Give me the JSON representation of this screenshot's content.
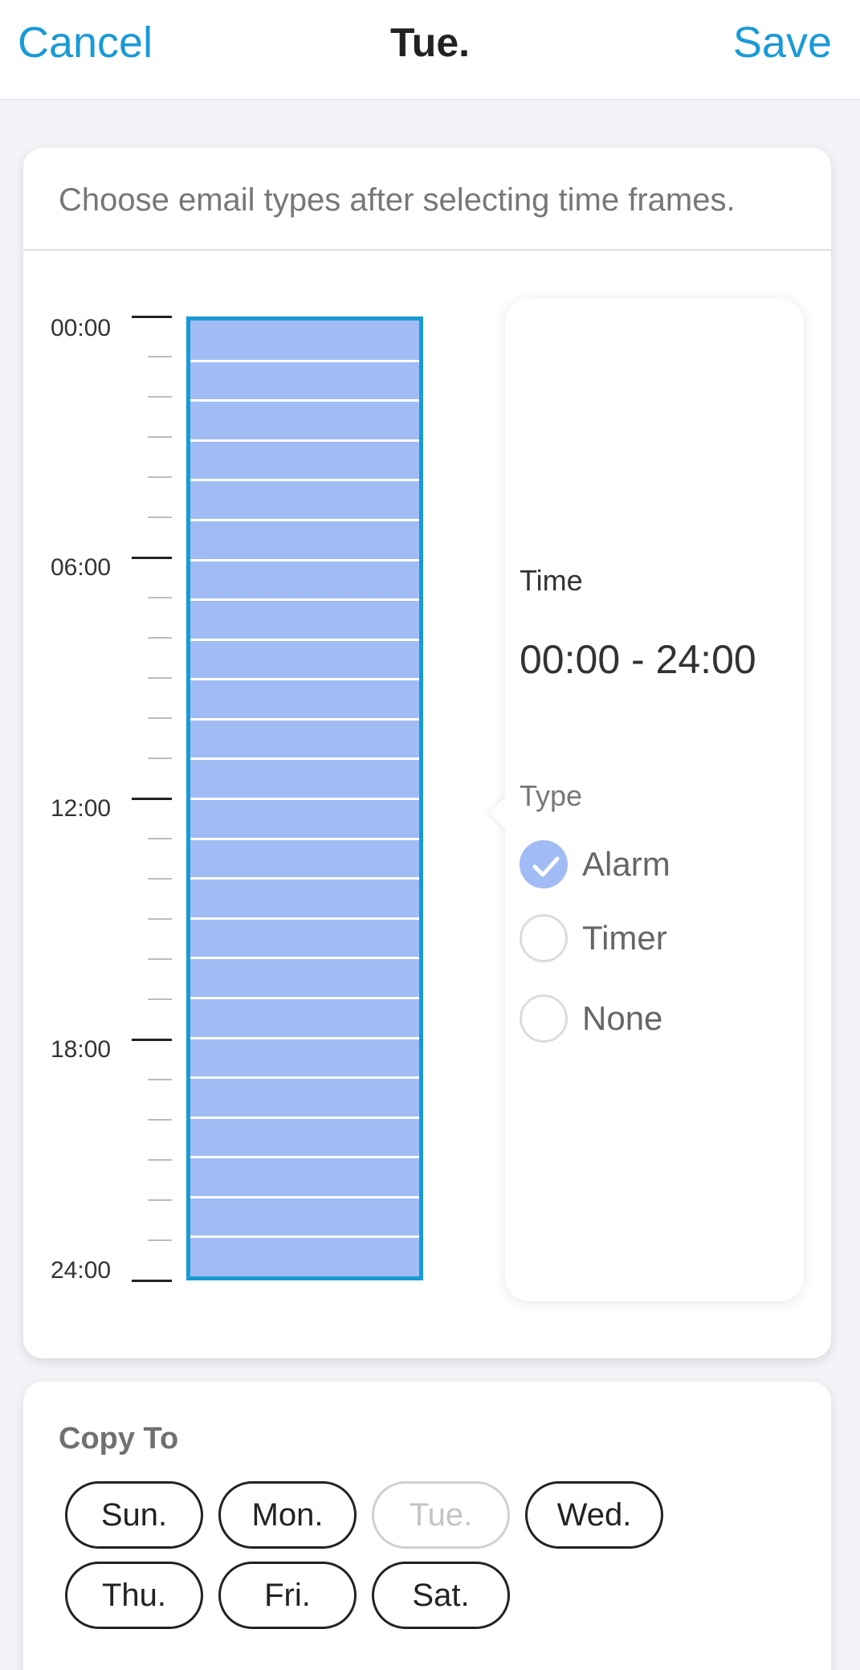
{
  "header": {
    "cancel_label": "Cancel",
    "title": "Tue.",
    "save_label": "Save"
  },
  "schedule": {
    "hint": "Choose email types after selecting time frames.",
    "axis_labels": [
      "00:00",
      "06:00",
      "12:00",
      "18:00",
      "24:00"
    ],
    "selected_fill_color": "#a1bcf5",
    "selected_border_color": "#189ad5"
  },
  "popup": {
    "time_label": "Time",
    "time_value": "00:00 - 24:00",
    "type_label": "Type",
    "options": [
      {
        "label": "Alarm",
        "checked": true
      },
      {
        "label": "Timer",
        "checked": false
      },
      {
        "label": "None",
        "checked": false
      }
    ]
  },
  "copy_to": {
    "title": "Copy To",
    "days": [
      {
        "label": "Sun.",
        "disabled": false
      },
      {
        "label": "Mon.",
        "disabled": false
      },
      {
        "label": "Tue.",
        "disabled": true
      },
      {
        "label": "Wed.",
        "disabled": false
      },
      {
        "label": "Thu.",
        "disabled": false
      },
      {
        "label": "Fri.",
        "disabled": false
      },
      {
        "label": "Sat.",
        "disabled": false
      }
    ]
  },
  "colors": {
    "accent": "#1a9ad6"
  }
}
